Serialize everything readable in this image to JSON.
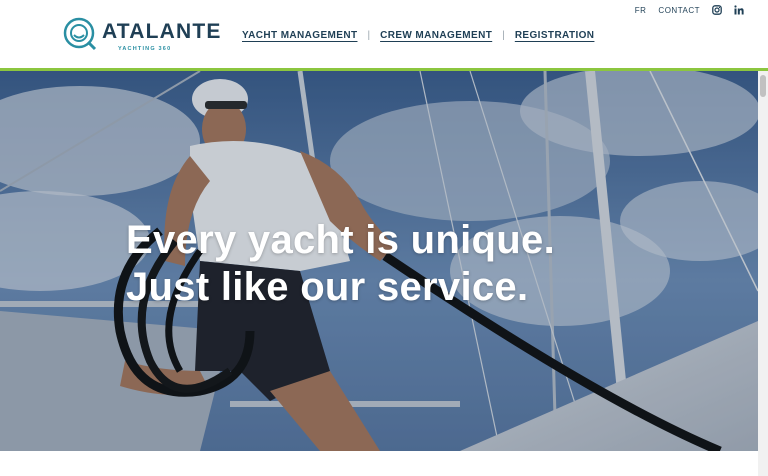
{
  "brand": {
    "name": "ATALANTE",
    "tagline": "YACHTING 360"
  },
  "utility_nav": {
    "language": "FR",
    "contact": "CONTACT",
    "icons": [
      "instagram-icon",
      "linkedin-icon"
    ]
  },
  "main_nav": [
    {
      "label": "YACHT MANAGEMENT"
    },
    {
      "label": "CREW MANAGEMENT"
    },
    {
      "label": "REGISTRATION"
    }
  ],
  "hero": {
    "line1": "Every yacht is unique.",
    "line2": "Just like our service."
  },
  "colors": {
    "brand_navy": "#1f3f55",
    "brand_teal": "#2a8fa3",
    "accent_green": "#8cc63f"
  }
}
